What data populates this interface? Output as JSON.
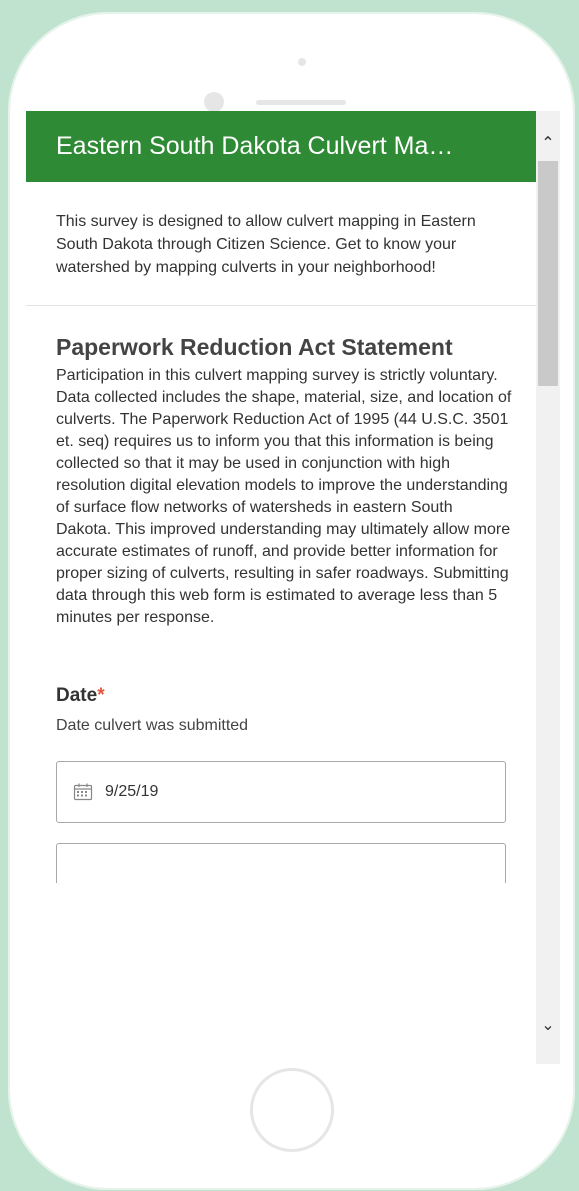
{
  "app": {
    "title": "Eastern South Dakota Culvert Ma…",
    "intro": "This survey is designed to allow culvert mapping in Eastern South Dakota through Citizen Science. Get to know your watershed by mapping culverts in your neighborhood!"
  },
  "paperwork": {
    "heading": "Paperwork Reduction Act Statement",
    "body": "Participation in this culvert mapping survey is strictly voluntary. Data collected includes the shape, material, size, and location of culverts. The Paperwork Reduction Act of 1995 (44 U.S.C. 3501 et. seq) requires us to inform you that this information is being collected so that it may be used in conjunction with high resolution digital elevation models to improve the understanding of surface flow networks of watersheds in eastern South Dakota. This improved understanding may ultimately allow more accurate estimates of runoff, and provide better information for proper sizing of culverts, resulting in safer roadways. Submitting data through this web form is estimated to average less than 5 minutes per response."
  },
  "date_question": {
    "label": "Date",
    "required_mark": "*",
    "hint": "Date culvert was submitted",
    "value": "9/25/19",
    "icon": "calendar-icon"
  },
  "scrollbar": {
    "up_icon": "chevron-up-icon",
    "down_icon": "chevron-down-icon",
    "up_glyph": "⌃",
    "down_glyph": "⌄"
  },
  "colors": {
    "header_bg": "#2e8a34",
    "required": "#e0573d",
    "frame_bg": "#bfe3cf"
  }
}
